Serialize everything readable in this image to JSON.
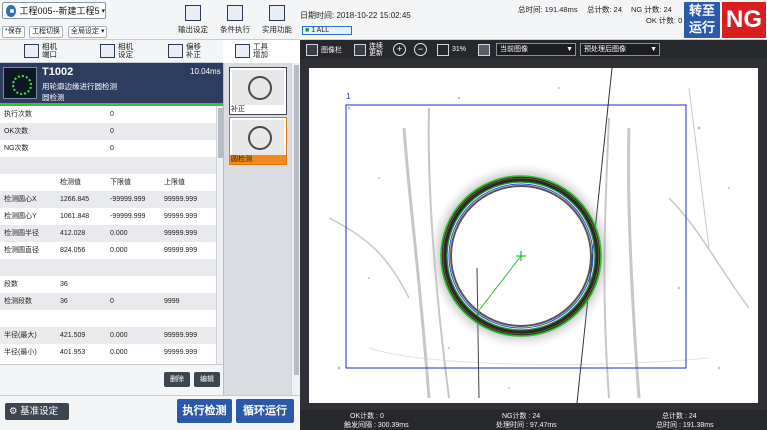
{
  "project": {
    "title": "工程005--新建工程5",
    "save_label": "*保存",
    "switch_label": "工程切换",
    "global_label": "全局设定"
  },
  "toolbar": {
    "output_settings": "输出设定",
    "conditional_exec": "条件执行",
    "utilities": "实用功能"
  },
  "header": {
    "date": "日期时间: 2018-10-22 15:02:45",
    "badge_num": "1",
    "badge_all": "ALL",
    "total_time": "总时间: 191.48ms",
    "total_count": "总计数: 24",
    "ng_count": "NG 计数: 24",
    "ok_count": "OK 计数: 0",
    "mode_label": "转至运行",
    "result": "NG",
    "colors": {
      "ng": "#d81e1e",
      "accent": "#2a5aa9",
      "ok_green": "#3fbf3f"
    }
  },
  "left_nav": {
    "camera_port": "相机端口",
    "camera_settings": "相机设定",
    "compensation": "偏移补正",
    "add_tool": "工具增加"
  },
  "tool_card": {
    "id": "T1002",
    "time": "10.04ms",
    "name": "用轮廓边缘进行圆检测",
    "subtitle": "圆检测"
  },
  "details": {
    "exec_count": {
      "label": "执行次数",
      "value": "0"
    },
    "ok_count": {
      "label": "OK次数",
      "value": "0"
    },
    "ng_count": {
      "label": "NG次数",
      "value": "0"
    },
    "columns": {
      "measured": "检测值",
      "lower": "下限值",
      "upper": "上限值"
    },
    "rows": [
      {
        "label": "检测圆心X",
        "measured": "1266.845",
        "lower": "-99999.999",
        "upper": "99999.999"
      },
      {
        "label": "检测圆心Y",
        "measured": "1061.848",
        "lower": "-99999.999",
        "upper": "99999.999"
      },
      {
        "label": "检测圆半径",
        "measured": "412.028",
        "lower": "0.000",
        "upper": "99999.999"
      },
      {
        "label": "检测圆直径",
        "measured": "824.056",
        "lower": "0.000",
        "upper": "99999.999"
      }
    ],
    "seg_rows": [
      {
        "label": "段数",
        "measured": "36",
        "lower": "",
        "upper": ""
      },
      {
        "label": "检测段数",
        "measured": "36",
        "lower": "0",
        "upper": "9999"
      }
    ],
    "radius_rows": [
      {
        "label": "半径(最大)",
        "measured": "421.509",
        "lower": "0.000",
        "upper": "99999.999"
      },
      {
        "label": "半径(最小)",
        "measured": "401.953",
        "lower": "0.000",
        "upper": "99999.999"
      }
    ],
    "delete_label": "删除",
    "edit_label": "编辑"
  },
  "thumbnails": [
    {
      "label": "补正"
    },
    {
      "label": "圆检测"
    }
  ],
  "bottom": {
    "base_settings": "基准设定",
    "run_detect": "执行检测",
    "loop_run": "循环运行"
  },
  "image_toolbar": {
    "image_bar": "图像栏",
    "continuous_update": "连续更新",
    "zoom": "31%",
    "current_image": "当前图像",
    "preprocessed_image": "预处理后图像"
  },
  "viewer": {
    "roi_label": "1"
  },
  "stats": {
    "ok_count": "OK计数 : 0",
    "ng_count": "NG计数 : 24",
    "total_count": "总计数 : 24",
    "trigger_interval": "触发间隔 : 300.39ms",
    "process_time": "处理时间 : 97.47ms",
    "total_time": "总时间 : 191.38ms"
  }
}
